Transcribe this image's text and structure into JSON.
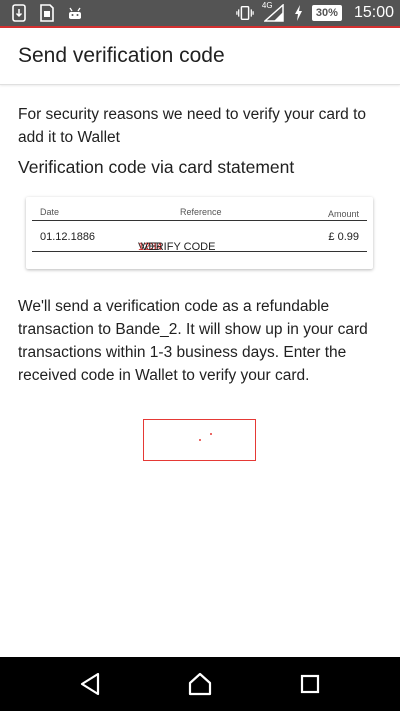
{
  "status_bar": {
    "network_label": "4G",
    "battery": "30%",
    "time": "15:00"
  },
  "app_bar": {
    "title": "Send verification code"
  },
  "content": {
    "intro_text": "For security reasons we need to verify your card to add it to Wallet",
    "section_title": "Verification code via card statement",
    "statement": {
      "headers": {
        "date": "Date",
        "reference": "Reference",
        "amount": "Amount"
      },
      "row": {
        "date": "01.12.1886",
        "ref_prefix": "VOD ",
        "ref_code": "1234",
        "ref_suffix": " VERIFY CODE",
        "amount": "£ 0.99"
      }
    },
    "info_text": "We'll send a verification code as a refundable transaction to Bande_2. It will show up in your card transactions within 1-3 business days. Enter the received code in Wallet to verify your card."
  },
  "colors": {
    "status_bar": "#545454",
    "accent": "#d32f2f",
    "nav_bar": "#000000"
  },
  "icons": {
    "status_left": [
      "phone-sync-icon",
      "sim-card-icon",
      "android-icon"
    ],
    "status_right": [
      "vibrate-icon",
      "signal-icon",
      "charging-icon",
      "battery-icon"
    ],
    "nav": [
      "back-icon",
      "home-icon",
      "recent-apps-icon"
    ]
  }
}
